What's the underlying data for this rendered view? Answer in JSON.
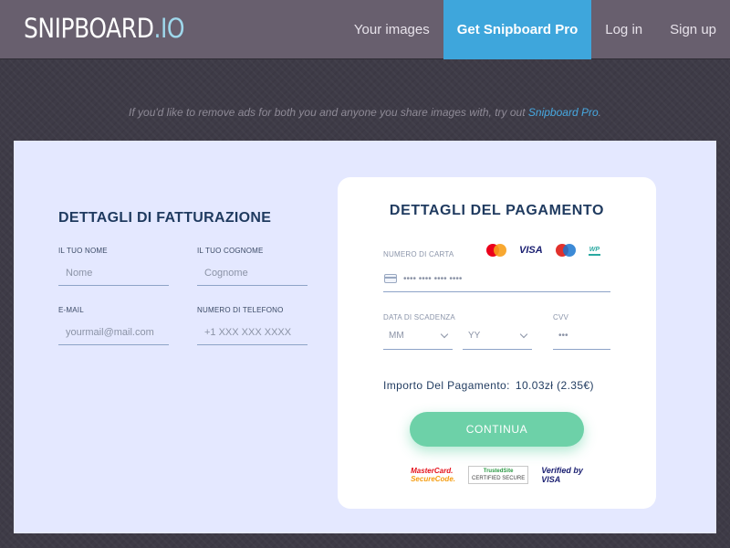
{
  "header": {
    "logo_main": "SNIPBOARD",
    "logo_dot": ".IO",
    "nav": {
      "your_images": "Your images",
      "get_pro": "Get Snipboard Pro",
      "login": "Log in",
      "signup": "Sign up"
    }
  },
  "ad_notice": {
    "text": "If you'd like to remove ads for both you and anyone you share images with, try out",
    "link": "Snipboard Pro",
    "end": "."
  },
  "billing": {
    "title": "DETTAGLI DI FATTURAZIONE",
    "first_name": {
      "label": "IL TUO NOME",
      "placeholder": "Nome"
    },
    "last_name": {
      "label": "IL TUO COGNOME",
      "placeholder": "Cognome"
    },
    "email": {
      "label": "E-MAIL",
      "placeholder": "yourmail@mail.com"
    },
    "phone": {
      "label": "NUMERO DI TELEFONO",
      "placeholder": "+1 XXX XXX XXXX"
    }
  },
  "payment": {
    "title": "DETTAGLI DEL PAGAMENTO",
    "card_number_label": "NUMERO DI CARTA",
    "card_number_placeholder": "•••• •••• •••• ••••",
    "brands": {
      "visa": "VISA",
      "wp": "WP"
    },
    "expiry_label": "DATA DI SCADENZA",
    "month_placeholder": "MM",
    "year_placeholder": "YY",
    "cvv_label": "CVV",
    "cvv_placeholder": "•••",
    "amount_label": "Importo Del Pagamento:",
    "amount_value": "10.03zł (2.35€)",
    "continue_label": "CONTINUA",
    "trust": {
      "mc_line1": "MasterCard.",
      "mc_line2": "SecureCode.",
      "ts_line1": "TrustedSite",
      "ts_line2": "CERTIFIED SECURE",
      "visa_line1": "Verified by",
      "visa_line2": "VISA"
    }
  }
}
